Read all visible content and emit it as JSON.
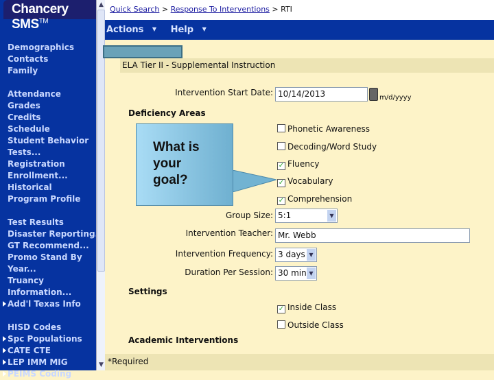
{
  "app": {
    "logo": "Chancery SMS",
    "logo_tm": "TM"
  },
  "sidebar": {
    "groups": [
      [
        {
          "label": "Demographics"
        },
        {
          "label": "Contacts"
        },
        {
          "label": "Family"
        }
      ],
      [
        {
          "label": "Attendance"
        },
        {
          "label": "Grades"
        },
        {
          "label": "Credits"
        },
        {
          "label": "Schedule"
        },
        {
          "label": "Student Behavior"
        },
        {
          "label": "Tests..."
        },
        {
          "label": "Registration"
        },
        {
          "label": "Enrollment..."
        },
        {
          "label": "Historical"
        },
        {
          "label": "Program Profile"
        }
      ],
      [
        {
          "label": "Test Results"
        },
        {
          "label": "Disaster Reporting..."
        },
        {
          "label": "GT Recommend..."
        },
        {
          "label": "Promo Stand By"
        },
        {
          "label": "Year..."
        },
        {
          "label": "Truancy"
        },
        {
          "label": "Information..."
        },
        {
          "label": "Add'l Texas Info",
          "expandable": true
        }
      ],
      [
        {
          "label": "HISD Codes"
        },
        {
          "label": "Spc Populations",
          "expandable": true
        },
        {
          "label": "CATE CTE",
          "expandable": true
        },
        {
          "label": "LEP IMM MIG",
          "expandable": true
        },
        {
          "label": "PEIMS Coding",
          "expandable": true
        }
      ]
    ]
  },
  "breadcrumb": {
    "items": [
      "Quick Search",
      "Response To Interventions"
    ],
    "current": "RTI",
    "separator": ">"
  },
  "toolbar": {
    "actions": "Actions",
    "help": "Help"
  },
  "form": {
    "section_title": "ELA Tier II - Supplemental Instruction",
    "start_date_label": "Intervention Start Date:",
    "start_date_value": "10/14/2013",
    "date_format": "m/d/yyyy",
    "deficiency_heading": "Deficiency Areas",
    "deficiency_areas": [
      {
        "label": "Phonetic Awareness",
        "checked": false
      },
      {
        "label": "Decoding/Word Study",
        "checked": false
      },
      {
        "label": "Fluency",
        "checked": true
      },
      {
        "label": "Vocabulary",
        "checked": true
      },
      {
        "label": "Comprehension",
        "checked": true
      }
    ],
    "group_size_label": "Group Size:",
    "group_size_value": "5:1",
    "teacher_label": "Intervention Teacher:",
    "teacher_value": "Mr. Webb",
    "frequency_label": "Intervention Frequency:",
    "frequency_value": "3 days",
    "duration_label": "Duration Per Session:",
    "duration_value": "30 min",
    "settings_heading": "Settings",
    "settings": [
      {
        "label": "Inside Class",
        "checked": true
      },
      {
        "label": "Outside Class",
        "checked": false
      }
    ],
    "academic_heading": "Academic Interventions"
  },
  "callout": {
    "lines": [
      "What is",
      "your",
      "goal?"
    ]
  },
  "footer": {
    "required": "*Required"
  }
}
